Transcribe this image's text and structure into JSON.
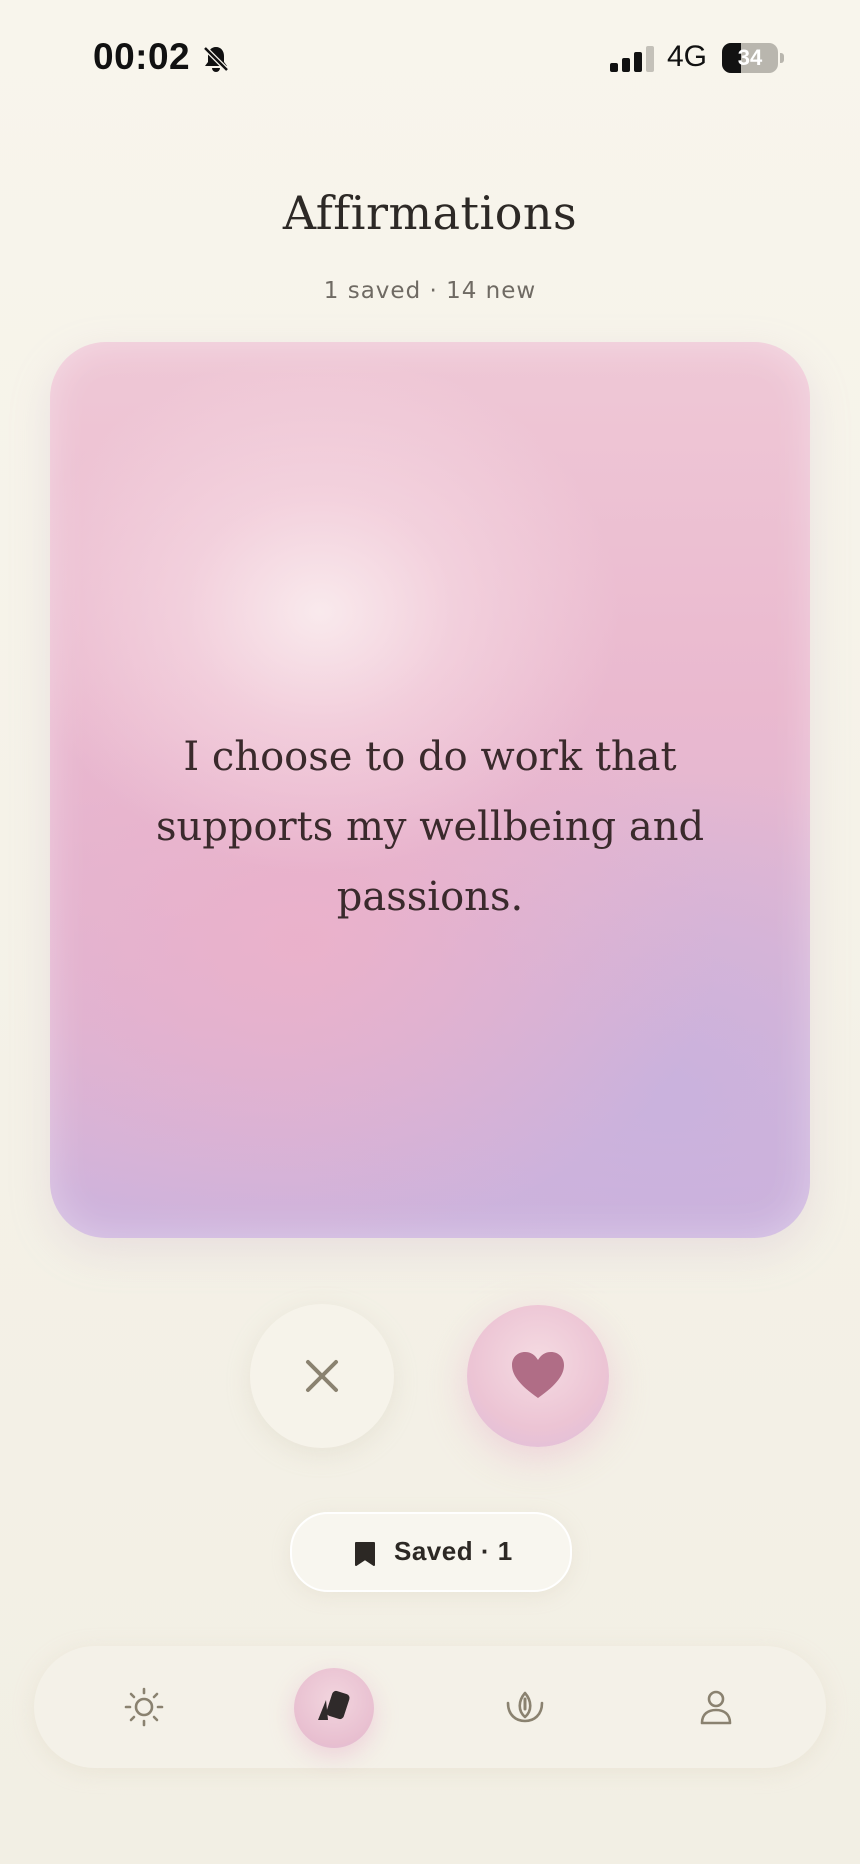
{
  "status_bar": {
    "time": "00:02",
    "network": "4G",
    "battery": "34",
    "battery_level": 0.34,
    "icons": [
      "bell-slash-icon",
      "signal-icon",
      "battery-icon"
    ]
  },
  "header": {
    "title": "Affirmations",
    "subtitle": "1 saved · 14 new"
  },
  "card": {
    "text": "I choose to do work that supports my wellbeing and passions."
  },
  "actions": {
    "dismiss_icon": "close-icon",
    "like_icon": "heart-icon"
  },
  "saved_button": {
    "label": "Saved · 1",
    "icon": "bookmark-icon"
  },
  "tab_bar": {
    "tabs": [
      {
        "icon": "sun-icon",
        "active": false
      },
      {
        "icon": "cards-icon",
        "active": true
      },
      {
        "icon": "lotus-icon",
        "active": false
      },
      {
        "icon": "profile-icon",
        "active": false
      }
    ]
  },
  "colors": {
    "background": "#f6f3ea",
    "accent_pink": "#ecc4d4",
    "heart": "#b06d86",
    "muted_icon": "#8a8270"
  }
}
